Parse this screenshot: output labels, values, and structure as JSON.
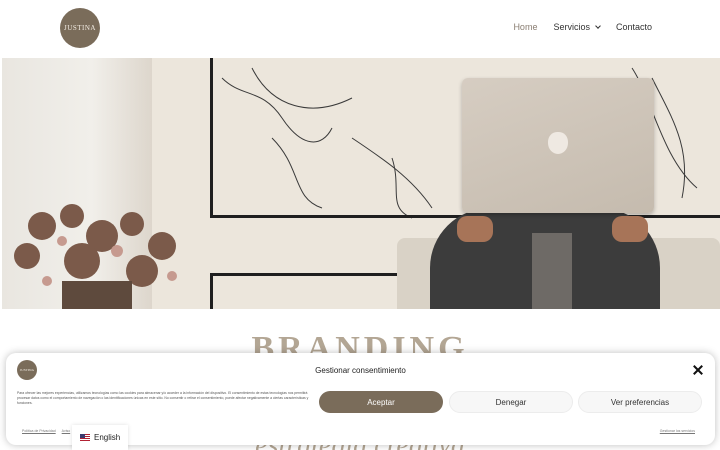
{
  "header": {
    "logo_text": "JUSTINA",
    "nav": [
      {
        "label": "Home",
        "active": true
      },
      {
        "label": "Servicios",
        "has_dropdown": true
      },
      {
        "label": "Contacto"
      }
    ]
  },
  "hero": {
    "image_description_icon": "workspace-photo"
  },
  "section": {
    "title": "BRANDING",
    "subtitle": "estrategia creativa"
  },
  "consent": {
    "logo_text": "JUSTINA",
    "title": "Gestionar consentimiento",
    "body": "Para ofrecer las mejores experiencias, utilizamos tecnologías como las cookies para almacenar y/o acceder a la información del dispositivo. El consentimiento de estas tecnologías nos permitirá procesar datos como el comportamiento de navegación o las identificaciones únicas en este sitio. No consentir o retirar el consentimiento, puede afectar negativamente a ciertas características y funciones.",
    "accept_label": "Aceptar",
    "deny_label": "Denegar",
    "prefs_label": "Ver preferencias",
    "links": [
      "Política de Privacidad",
      "Aviso"
    ],
    "right_link": "Gestionar los servicios"
  },
  "language": {
    "label": "English",
    "flag_icon": "us-flag-icon"
  },
  "colors": {
    "brand": "#7a6c5a",
    "heading": "#b3a694"
  }
}
